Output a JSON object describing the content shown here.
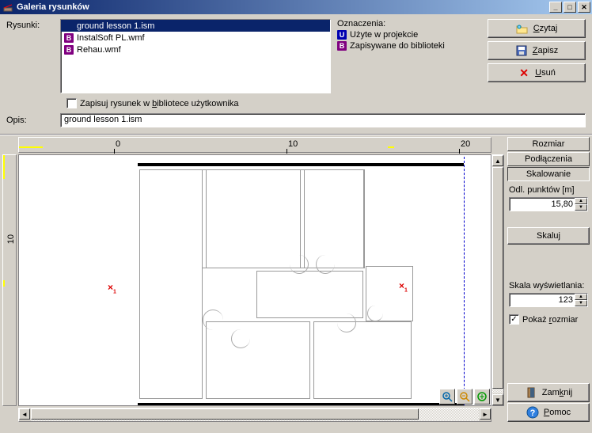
{
  "window": {
    "title": "Galeria rysunków"
  },
  "labels": {
    "rysunki": "Rysunki:",
    "opis": "Opis:",
    "legend_title": "Oznaczenia:",
    "legend_used": "Użyte w projekcie",
    "legend_saved": "Zapisywane do biblioteki",
    "save_to_lib": "Zapisuj rysunek w bibliotece użytkownika"
  },
  "files": [
    {
      "icon": "",
      "name": "ground lesson 1.ism",
      "selected": true
    },
    {
      "icon": "B",
      "name": "InstalSoft PL.wmf",
      "selected": false
    },
    {
      "icon": "B",
      "name": "Rehau.wmf",
      "selected": false
    }
  ],
  "buttons": {
    "czytaj": "Czytaj",
    "zapisz": "Zapisz",
    "usun": "Usuń",
    "zamknij": "Zamknij",
    "pomoc": "Pomoc"
  },
  "opis_value": "ground lesson 1.ism",
  "side": {
    "rozmiar": "Rozmiar",
    "podlaczenia": "Podłączenia",
    "skalowanie": "Skalowanie",
    "odl_punktow": "Odl. punktów [m]",
    "odl_value": "15,80",
    "skaluj_btn": "Skaluj",
    "skala_wys": "Skala wyświetlania:",
    "skala_value": "123",
    "pokaz_rozmiar": "Pokaż rozmiar"
  },
  "ruler": {
    "h0": "0",
    "h10": "10",
    "h20": "20",
    "v10": "10"
  }
}
